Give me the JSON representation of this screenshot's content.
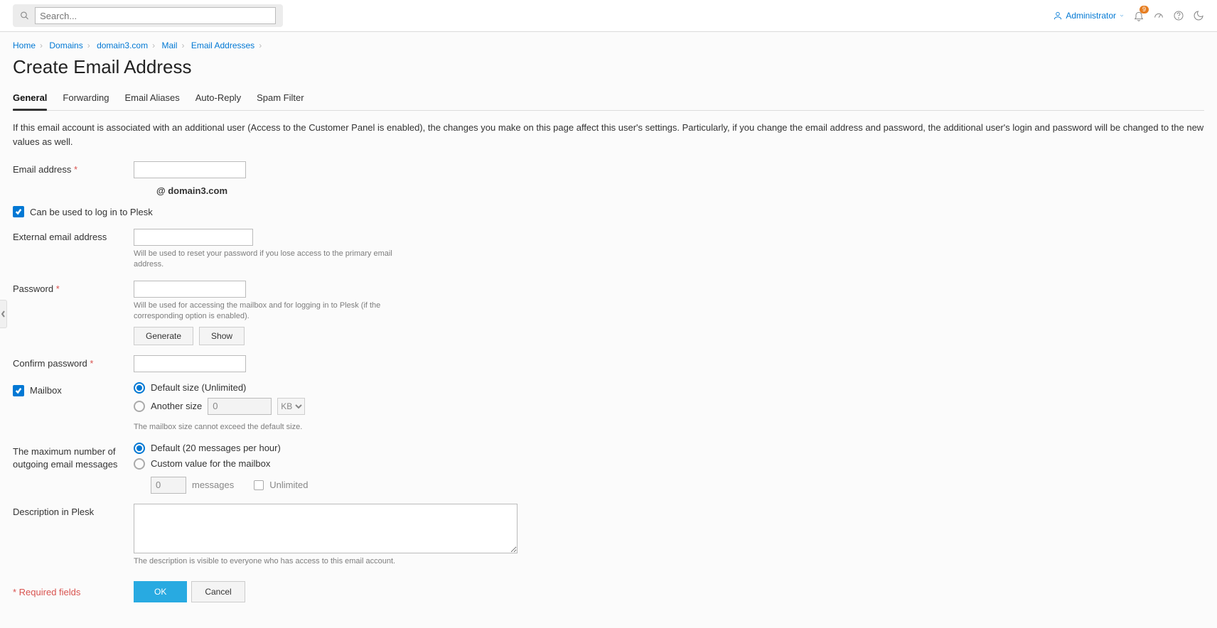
{
  "search": {
    "placeholder": "Search..."
  },
  "header": {
    "user": "Administrator",
    "notification_count": "9"
  },
  "breadcrumb": {
    "items": [
      "Home",
      "Domains",
      "domain3.com",
      "Mail",
      "Email Addresses"
    ]
  },
  "page": {
    "title": "Create Email Address",
    "description": "If this email account is associated with an additional user (Access to the Customer Panel is enabled), the changes you make on this page affect this user's settings. Particularly, if you change the email address and password, the additional user's login and password will be changed to the new values as well."
  },
  "tabs": [
    "General",
    "Forwarding",
    "Email Aliases",
    "Auto-Reply",
    "Spam Filter"
  ],
  "form": {
    "email_label": "Email address",
    "domain_suffix": "@ domain3.com",
    "login_checkbox": "Can be used to log in to Plesk",
    "external_email_label": "External email address",
    "external_email_hint": "Will be used to reset your password if you lose access to the primary email address.",
    "password_label": "Password",
    "password_hint": "Will be used for accessing the mailbox and for logging in to Plesk (if the corresponding option is enabled).",
    "generate_btn": "Generate",
    "show_btn": "Show",
    "confirm_password_label": "Confirm password",
    "mailbox_label": "Mailbox",
    "mailbox_default": "Default size (Unlimited)",
    "mailbox_another": "Another size",
    "mailbox_another_value": "0",
    "mailbox_unit": "KB",
    "mailbox_hint": "The mailbox size cannot exceed the default size.",
    "outgoing_label": "The maximum number of outgoing email messages",
    "outgoing_default": "Default (20 messages per hour)",
    "outgoing_custom": "Custom value for the mailbox",
    "outgoing_custom_value": "0",
    "outgoing_messages_suffix": "messages",
    "outgoing_unlimited": "Unlimited",
    "description_label": "Description in Plesk",
    "description_hint": "The description is visible to everyone who has access to this email account.",
    "required_note": "* Required fields",
    "ok_btn": "OK",
    "cancel_btn": "Cancel"
  }
}
